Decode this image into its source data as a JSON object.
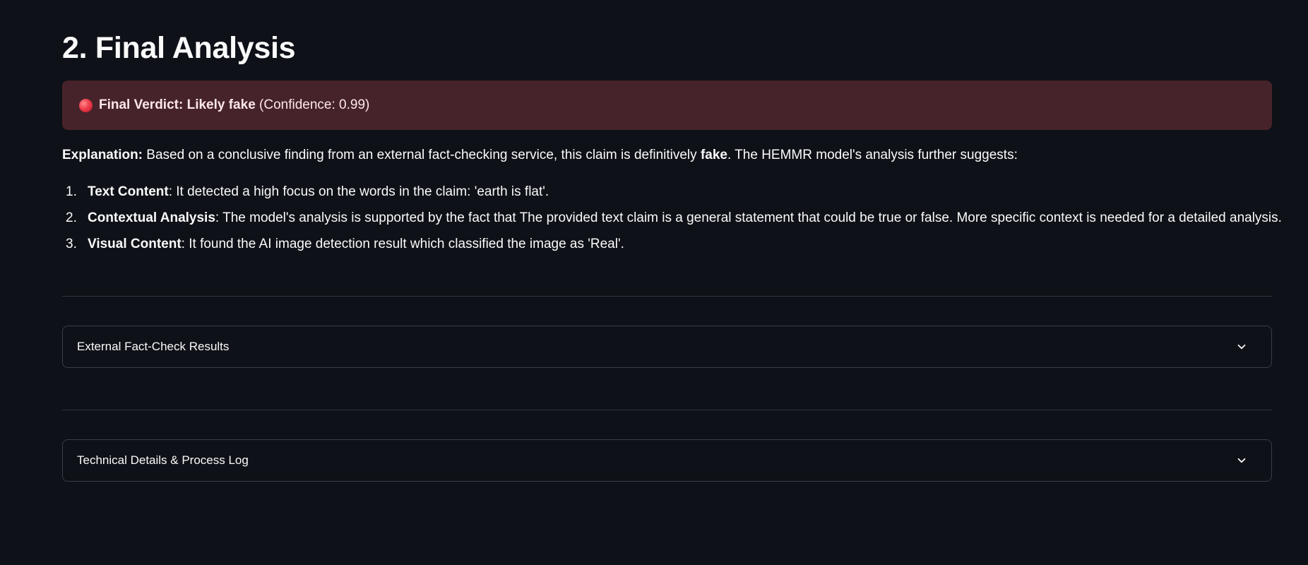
{
  "page": {
    "title": "2. Final Analysis"
  },
  "verdict": {
    "icon": "red-circle-icon",
    "label": "Final Verdict: Likely fake",
    "confidence": "(Confidence: 0.99)",
    "background_color": "#46232a"
  },
  "explanation": {
    "label": "Explanation:",
    "text_before": " Based on a conclusive finding from an external fact-checking service, this claim is definitively ",
    "emphasis": "fake",
    "text_after": ". The HEMMR model's analysis further suggests:"
  },
  "points": [
    {
      "number": "1.",
      "title": "Text Content",
      "text": ": It detected a high focus on the words in the claim: 'earth is flat'."
    },
    {
      "number": "2.",
      "title": "Contextual Analysis",
      "text": ": The model's analysis is supported by the fact that The provided text claim is a general statement that could be true or false. More specific context is needed for a detailed analysis."
    },
    {
      "number": "3.",
      "title": "Visual Content",
      "text": ": It found the AI image detection result which classified the image as 'Real'."
    }
  ],
  "expanders": [
    {
      "label": "External Fact-Check Results",
      "icon": "chevron-down-icon"
    },
    {
      "label": "Technical Details & Process Log",
      "icon": "chevron-down-icon"
    }
  ],
  "colors": {
    "background": "#0e1117",
    "text": "#fafafa",
    "divider": "#31333f",
    "expander_border": "#3a3d49"
  }
}
